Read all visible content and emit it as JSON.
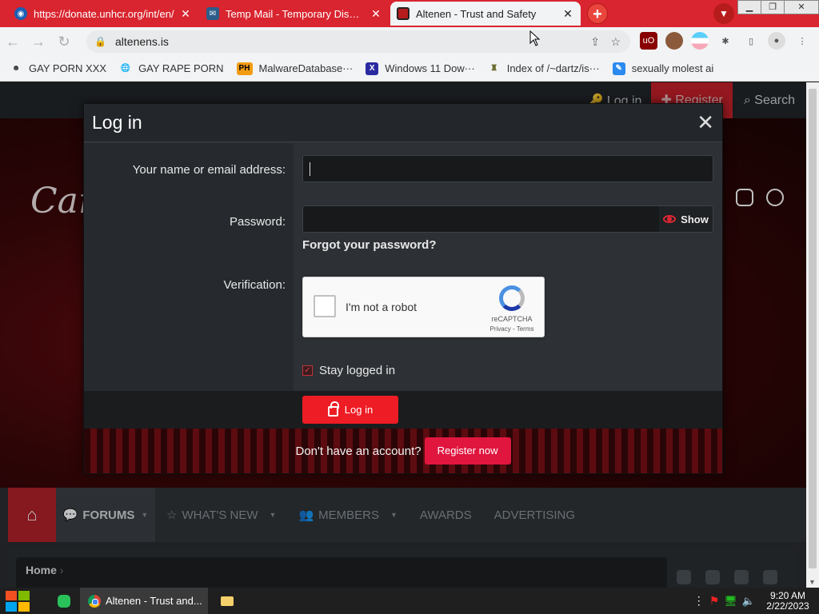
{
  "browser": {
    "tabs": [
      {
        "title": "https://donate.unhcr.org/int/en/",
        "active": false,
        "icon": "unhcr-icon"
      },
      {
        "title": "Temp Mail - Temporary Disposable",
        "active": false,
        "icon": "mail-icon"
      },
      {
        "title": "Altenen - Trust and Safety",
        "active": true,
        "icon": "altenen-icon"
      }
    ],
    "new_tab_label": "+",
    "url": "altenens.is",
    "bookmarks": [
      {
        "label": "GAY PORN XXX"
      },
      {
        "label": "GAY RAPE PORN"
      },
      {
        "label": "MalwareDatabase···",
        "badge": "PH"
      },
      {
        "label": "Windows 11 Dow···"
      },
      {
        "label": "Index of /~dartz/is···"
      },
      {
        "label": "sexually molest ai"
      }
    ]
  },
  "site": {
    "top_nav": {
      "login": "Log in",
      "register": "Register",
      "search": "Search"
    },
    "logo_text": "Cara",
    "main_nav": [
      {
        "label": "FORUMS",
        "has_caret": true
      },
      {
        "label": "WHAT'S NEW",
        "has_caret": true
      },
      {
        "label": "MEMBERS",
        "has_caret": true
      },
      {
        "label": "AWARDS",
        "has_caret": false
      },
      {
        "label": "ADVERTISING",
        "has_caret": false
      }
    ],
    "breadcrumb": "Home"
  },
  "modal": {
    "title": "Log in",
    "username_label": "Your name or email address:",
    "username_value": "",
    "password_label": "Password:",
    "password_value": "",
    "show_label": "Show",
    "forgot_label": "Forgot your password?",
    "verification_label": "Verification:",
    "captcha": {
      "text": "I'm not a robot",
      "brand": "reCAPTCHA",
      "terms": "Privacy - Terms"
    },
    "stay_logged_in_label": "Stay logged in",
    "stay_logged_in_checked": true,
    "login_button": "Log in",
    "register_prompt": "Don't have an account?",
    "register_button": "Register now"
  },
  "taskbar": {
    "chrome_title": "Altenen - Trust and...",
    "time": "9:20 AM",
    "date": "2/22/2023"
  },
  "colors": {
    "accent": "#ee1c25",
    "register": "#e0163f",
    "tabbar": "#d9252f"
  }
}
